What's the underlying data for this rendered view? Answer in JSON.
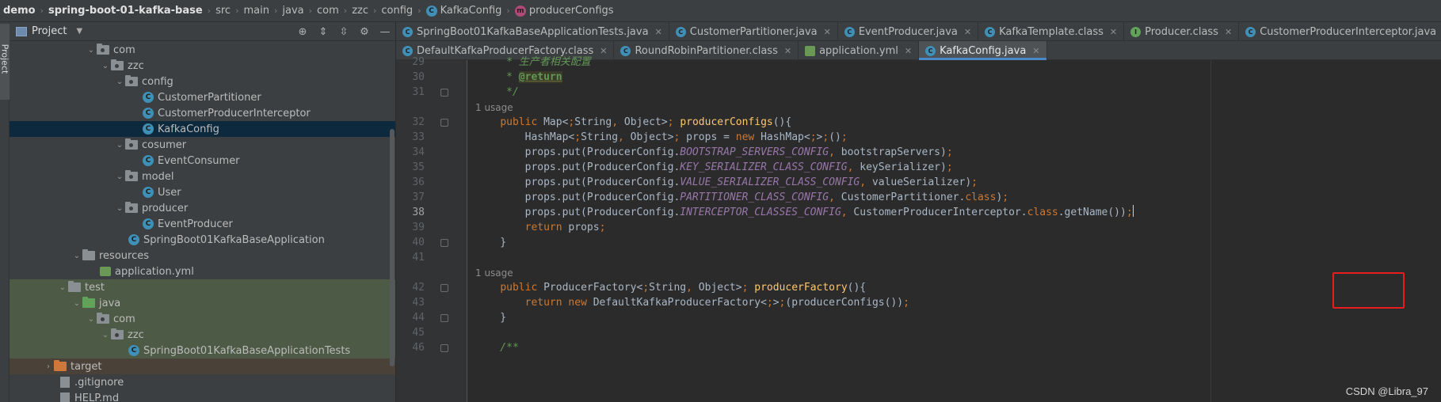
{
  "breadcrumb": {
    "items": [
      "demo",
      "spring-boot-01-kafka-base",
      "src",
      "main",
      "java",
      "com",
      "zzc",
      "config",
      "KafkaConfig",
      "producerConfigs"
    ]
  },
  "tool_strip": {
    "project_label": "Project"
  },
  "project_panel": {
    "title": "Project",
    "tree": [
      {
        "label": "com",
        "kind": "package",
        "expanded": true
      },
      {
        "label": "zzc",
        "kind": "package",
        "expanded": true
      },
      {
        "label": "config",
        "kind": "package",
        "expanded": true
      },
      {
        "label": "CustomerPartitioner",
        "kind": "class"
      },
      {
        "label": "CustomerProducerInterceptor",
        "kind": "class"
      },
      {
        "label": "KafkaConfig",
        "kind": "class",
        "selected": true
      },
      {
        "label": "cosumer",
        "kind": "package",
        "expanded": true
      },
      {
        "label": "EventConsumer",
        "kind": "class"
      },
      {
        "label": "model",
        "kind": "package",
        "expanded": true
      },
      {
        "label": "User",
        "kind": "class"
      },
      {
        "label": "producer",
        "kind": "package",
        "expanded": true
      },
      {
        "label": "EventProducer",
        "kind": "class"
      },
      {
        "label": "SpringBoot01KafkaBaseApplication",
        "kind": "class"
      },
      {
        "label": "resources",
        "kind": "folder",
        "expanded": true
      },
      {
        "label": "application.yml",
        "kind": "yml"
      },
      {
        "label": "test",
        "kind": "folder",
        "expanded": true
      },
      {
        "label": "java",
        "kind": "folder-green",
        "expanded": true
      },
      {
        "label": "com",
        "kind": "package",
        "expanded": true
      },
      {
        "label": "zzc",
        "kind": "package",
        "expanded": true
      },
      {
        "label": "SpringBoot01KafkaBaseApplicationTests",
        "kind": "class"
      },
      {
        "label": "target",
        "kind": "folder-orange",
        "expanded": false
      },
      {
        "label": ".gitignore",
        "kind": "file"
      },
      {
        "label": "HELP.md",
        "kind": "file"
      }
    ]
  },
  "tabs": {
    "row1": [
      {
        "label": "SpringBoot01KafkaBaseApplicationTests.java",
        "icon": "C"
      },
      {
        "label": "CustomerPartitioner.java",
        "icon": "C"
      },
      {
        "label": "EventProducer.java",
        "icon": "C"
      },
      {
        "label": "KafkaTemplate.class",
        "icon": "C"
      },
      {
        "label": "Producer.class",
        "icon": "I"
      },
      {
        "label": "CustomerProducerInterceptor.java",
        "icon": "C"
      }
    ],
    "row2": [
      {
        "label": "DefaultKafkaProducerFactory.class",
        "icon": "C"
      },
      {
        "label": "RoundRobinPartitioner.class",
        "icon": "C"
      },
      {
        "label": "application.yml",
        "icon": "Y"
      },
      {
        "label": "KafkaConfig.java",
        "icon": "C",
        "active": true
      }
    ]
  },
  "code": {
    "usage_hint": "1 usage",
    "lines": [
      {
        "n": "29",
        "t": "     * 生产者相关配置"
      },
      {
        "n": "30",
        "t": "     * @return"
      },
      {
        "n": "31",
        "t": "     */"
      },
      {
        "n": "32",
        "t": "    public Map<String, Object> producerConfigs(){"
      },
      {
        "n": "33",
        "t": "        HashMap<String, Object> props = new HashMap<>();"
      },
      {
        "n": "34",
        "t": "        props.put(ProducerConfig.BOOTSTRAP_SERVERS_CONFIG, bootstrapServers);"
      },
      {
        "n": "35",
        "t": "        props.put(ProducerConfig.KEY_SERIALIZER_CLASS_CONFIG, keySerializer);"
      },
      {
        "n": "36",
        "t": "        props.put(ProducerConfig.VALUE_SERIALIZER_CLASS_CONFIG, valueSerializer);"
      },
      {
        "n": "37",
        "t": "        props.put(ProducerConfig.PARTITIONER_CLASS_CONFIG, CustomerPartitioner.class);"
      },
      {
        "n": "38",
        "t": "        props.put(ProducerConfig.INTERCEPTOR_CLASSES_CONFIG, CustomerProducerInterceptor.class.getName());"
      },
      {
        "n": "39",
        "t": "        return props;"
      },
      {
        "n": "40",
        "t": "    }"
      },
      {
        "n": "41",
        "t": ""
      },
      {
        "n": "42",
        "t": "    public ProducerFactory<String, Object> producerFactory(){"
      },
      {
        "n": "43",
        "t": "        return new DefaultKafkaProducerFactory<>(producerConfigs());"
      },
      {
        "n": "44",
        "t": "    }"
      },
      {
        "n": "45",
        "t": ""
      },
      {
        "n": "46",
        "t": "    /**"
      }
    ]
  },
  "watermark": "CSDN @Libra_97",
  "colors": {
    "keyword": "#cc7832",
    "method": "#ffc66d",
    "constant": "#9876aa",
    "comment": "#629755",
    "highlight_box": "#e81c1c",
    "active_tab_underline": "#4a88c7"
  }
}
